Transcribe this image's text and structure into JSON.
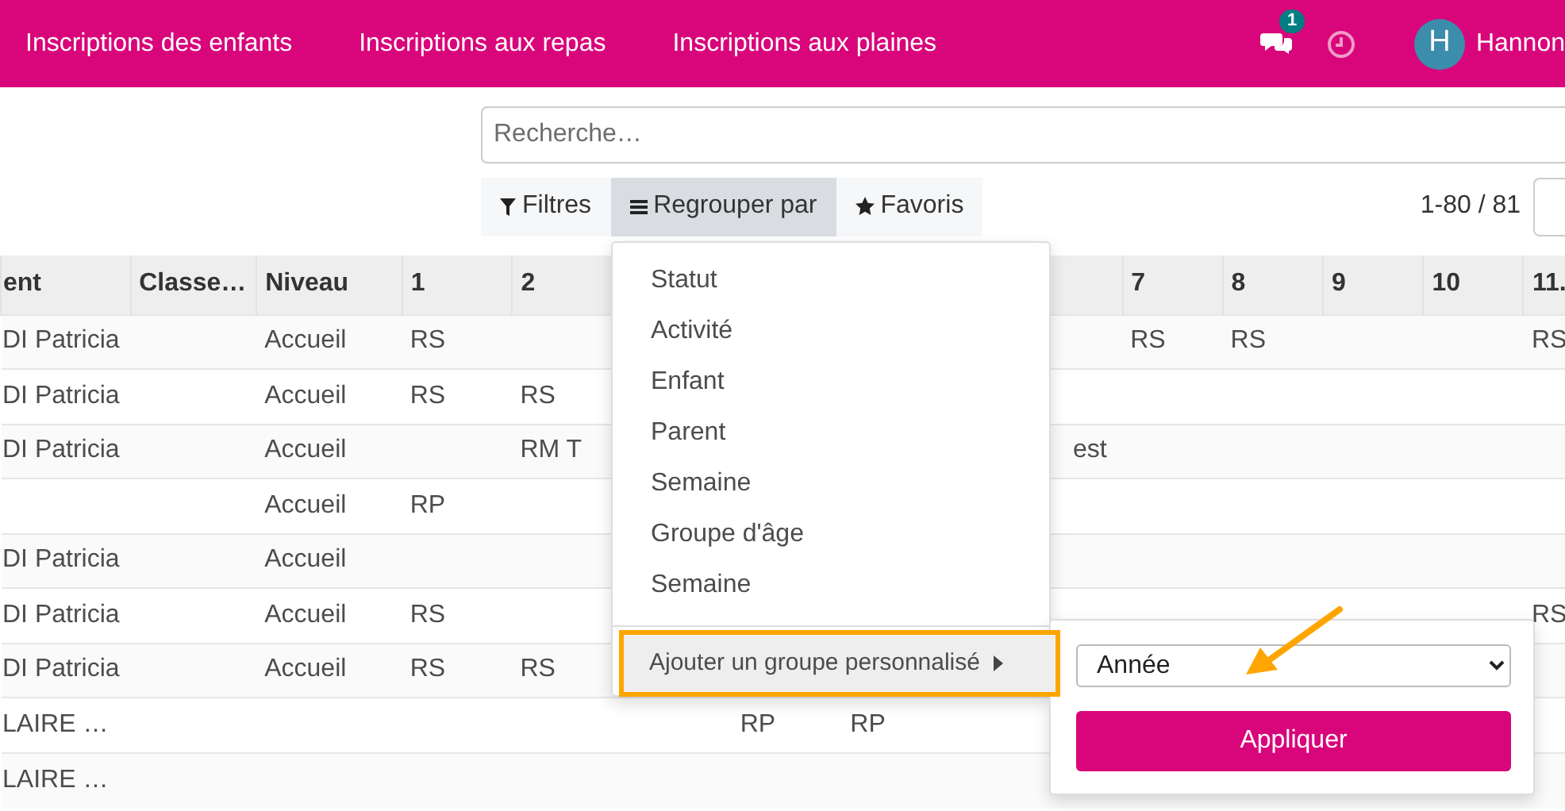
{
  "navbar": {
    "links": [
      {
        "label": "Inscriptions des enfants"
      },
      {
        "label": "Inscriptions aux repas"
      },
      {
        "label": "Inscriptions aux plaines"
      }
    ],
    "messages_badge": "1",
    "avatar_letter": "H",
    "user_name": "Hannon"
  },
  "search": {
    "placeholder": "Recherche…"
  },
  "toolbar": [
    {
      "label": "Filtres",
      "kind": "filter",
      "selected": false
    },
    {
      "label": "Regrouper par",
      "kind": "group",
      "selected": true
    },
    {
      "label": "Favoris",
      "kind": "star",
      "selected": false
    }
  ],
  "pager": "1-80 / 81",
  "table": {
    "columns": [
      "ent",
      "Classe…",
      "Niveau",
      "1",
      "2",
      null,
      null,
      null,
      null,
      "7",
      "8",
      "9",
      "10",
      "11."
    ],
    "rows": [
      [
        "DI Patricia",
        null,
        "Accueil",
        "RS",
        null,
        null,
        null,
        null,
        null,
        "RS",
        "RS",
        null,
        null,
        "RS"
      ],
      [
        "DI Patricia",
        null,
        "Accueil",
        "RS",
        "RS",
        null,
        null,
        null,
        null,
        null,
        null,
        null,
        null,
        null
      ],
      [
        "DI Patricia",
        null,
        "Accueil",
        null,
        "RM T",
        null,
        null,
        null,
        "est",
        null,
        null,
        null,
        null,
        null
      ],
      [
        null,
        null,
        "Accueil",
        "RP",
        null,
        null,
        null,
        null,
        null,
        null,
        null,
        null,
        null,
        null
      ],
      [
        "DI Patricia",
        null,
        "Accueil",
        null,
        null,
        null,
        null,
        null,
        null,
        null,
        null,
        null,
        null,
        null
      ],
      [
        "DI Patricia",
        null,
        "Accueil",
        "RS",
        null,
        null,
        null,
        null,
        null,
        null,
        null,
        null,
        null,
        "RS"
      ],
      [
        "DI Patricia",
        null,
        "Accueil",
        "RS",
        "RS",
        null,
        null,
        null,
        null,
        null,
        null,
        null,
        null,
        null
      ],
      [
        "LAIRE …",
        null,
        null,
        null,
        null,
        null,
        "RP",
        "RP",
        null,
        null,
        null,
        null,
        null,
        null
      ],
      [
        "LAIRE …",
        null,
        null,
        null,
        null,
        null,
        null,
        null,
        null,
        null,
        null,
        null,
        null,
        null
      ]
    ]
  },
  "group_menu": {
    "items": [
      {
        "label": "Statut",
        "kind": "option"
      },
      {
        "label": "Activité",
        "kind": "option"
      },
      {
        "label": "Enfant",
        "kind": "option"
      },
      {
        "label": "Parent",
        "kind": "option"
      },
      {
        "label": "Semaine",
        "kind": "option"
      },
      {
        "label": "Groupe d'âge",
        "kind": "option"
      },
      {
        "label": "Semaine",
        "kind": "option"
      },
      {
        "label": "Ajouter un groupe personnalisé",
        "kind": "submenu",
        "expanded": true,
        "highlighted": true
      }
    ]
  },
  "custom_group": {
    "select_value": "Année",
    "apply_button": "Appliquer"
  }
}
